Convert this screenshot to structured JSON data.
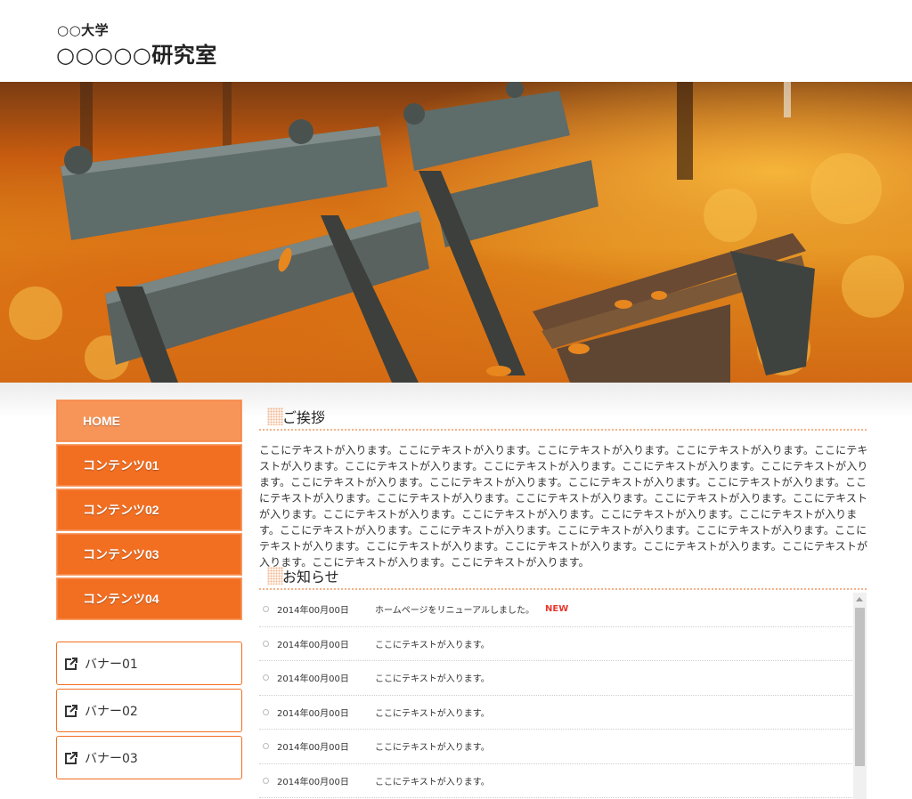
{
  "header": {
    "university": "○○大学",
    "lab_name": "○○○○○研究室"
  },
  "nav": {
    "items": [
      {
        "label": "HOME"
      },
      {
        "label": "コンテンツ01"
      },
      {
        "label": "コンテンツ02"
      },
      {
        "label": "コンテンツ03"
      },
      {
        "label": "コンテンツ04"
      }
    ]
  },
  "banners": [
    {
      "label": "バナー01",
      "icon": "external-link-icon"
    },
    {
      "label": "バナー02",
      "icon": "external-link-icon"
    },
    {
      "label": "バナー03",
      "icon": "external-link-icon"
    }
  ],
  "greeting": {
    "heading": "ご挨拶",
    "body": "ここにテキストが入ります。ここにテキストが入ります。ここにテキストが入ります。ここにテキストが入ります。ここにテキストが入ります。ここにテキストが入ります。ここにテキストが入ります。ここにテキストが入ります。ここにテキストが入ります。ここにテキストが入ります。ここにテキストが入ります。ここにテキストが入ります。ここにテキストが入ります。ここにテキストが入ります。ここにテキストが入ります。ここにテキストが入ります。ここにテキストが入ります。ここにテキストが入ります。ここにテキストが入ります。ここにテキストが入ります。ここにテキストが入ります。ここにテキストが入ります。ここにテキストが入ります。ここにテキストが入ります。ここにテキストが入ります。ここにテキストが入ります。ここにテキストが入ります。ここにテキストが入ります。ここにテキストが入ります。ここにテキストが入ります。ここにテキストが入ります。ここにテキストが入ります。ここにテキストが入ります。"
  },
  "news": {
    "heading": "お知らせ",
    "items": [
      {
        "date": "2014年00月00日",
        "text": "ホームページをリニューアルしました。",
        "badge": "NEW"
      },
      {
        "date": "2014年00月00日",
        "text": "ここにテキストが入ります。",
        "badge": ""
      },
      {
        "date": "2014年00月00日",
        "text": "ここにテキストが入ります。",
        "badge": ""
      },
      {
        "date": "2014年00月00日",
        "text": "ここにテキストが入ります。",
        "badge": ""
      },
      {
        "date": "2014年00月00日",
        "text": "ここにテキストが入ります。",
        "badge": ""
      },
      {
        "date": "2014年00月00日",
        "text": "ここにテキストが入ります。",
        "badge": ""
      }
    ]
  },
  "colors": {
    "accent": "#f26f22",
    "accent_light": "#f79559",
    "new_badge": "#e8382e"
  }
}
